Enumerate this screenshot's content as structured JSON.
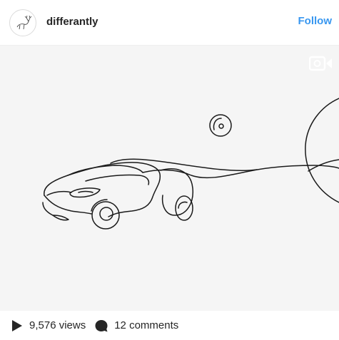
{
  "header": {
    "avatar_icon": "deer-sketch-avatar-icon",
    "username": "differantly",
    "follow_label": "Follow",
    "follow_color": "#3897f0"
  },
  "media": {
    "description_icon": "video-camera-icon",
    "content": "line-drawing-car"
  },
  "footer": {
    "play_icon": "play-icon",
    "views": "9,576 views",
    "comment_icon": "comment-bubble-icon",
    "comments": "12 comments"
  }
}
